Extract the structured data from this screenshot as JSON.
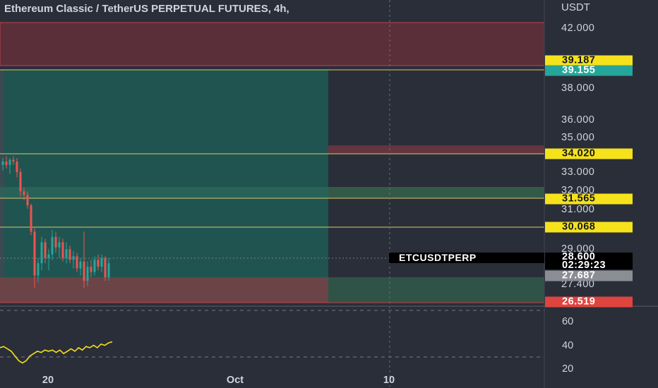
{
  "header": {
    "title": "Ethereum Classic / TetherUS PERPETUAL FUTURES, 4h,",
    "currency": "USDT"
  },
  "price_axis": {
    "ticks": [
      "42.000",
      "38.000",
      "36.000",
      "35.000",
      "33.000",
      "32.000",
      "31.000",
      "29.000",
      "27.400"
    ],
    "badges": [
      {
        "label": "39.187",
        "bg": "#f5e21b",
        "fg": "#131722"
      },
      {
        "label": "39.155",
        "bg": "#26a69a",
        "fg": "#ffffff"
      },
      {
        "label": "34.020",
        "bg": "#f5e21b",
        "fg": "#131722"
      },
      {
        "label": "31.565",
        "bg": "#f5e21b",
        "fg": "#131722"
      },
      {
        "label": "30.068",
        "bg": "#f5e21b",
        "fg": "#131722"
      },
      {
        "label": "27.687",
        "bg": "#8a8d94",
        "fg": "#ffffff"
      },
      {
        "label": "26.519",
        "bg": "#e0443e",
        "fg": "#ffffff"
      }
    ]
  },
  "last_price": {
    "symbol": "ETCUSDTPERP",
    "price": "28.600",
    "countdown": "02:29:23"
  },
  "oscillator_axis": {
    "ticks": [
      "60",
      "40",
      "20"
    ]
  },
  "time_axis": {
    "labels": [
      "20",
      "Oct",
      "10"
    ]
  },
  "colors": {
    "background": "#2a2e39",
    "up": "#26a69a",
    "down": "#ef5350",
    "level_line": "#f5e21b",
    "oscillator": "#f5e21b"
  },
  "chart_data": {
    "type": "candlestick",
    "symbol": "ETCUSDTPERP",
    "interval": "4h",
    "price_range": [
      26.0,
      43.0
    ],
    "ohlc": [
      [
        34.2,
        34.6,
        33.9,
        34.4
      ],
      [
        34.4,
        34.7,
        34.0,
        34.2
      ],
      [
        34.2,
        34.6,
        33.7,
        34.5
      ],
      [
        34.5,
        34.7,
        34.2,
        34.4
      ],
      [
        34.4,
        34.6,
        33.5,
        33.8
      ],
      [
        33.8,
        34.0,
        32.4,
        32.7
      ],
      [
        32.7,
        32.9,
        32.2,
        32.5
      ],
      [
        32.5,
        32.7,
        31.7,
        31.9
      ],
      [
        31.9,
        32.0,
        30.2,
        30.4
      ],
      [
        30.4,
        30.6,
        27.2,
        27.9
      ],
      [
        27.9,
        28.9,
        27.5,
        28.6
      ],
      [
        28.6,
        30.1,
        28.2,
        29.8
      ],
      [
        29.8,
        30.0,
        28.6,
        28.9
      ],
      [
        28.9,
        29.4,
        28.2,
        29.1
      ],
      [
        29.1,
        30.5,
        28.8,
        30.1
      ],
      [
        30.1,
        30.4,
        29.2,
        29.5
      ],
      [
        29.5,
        30.1,
        28.9,
        29.8
      ],
      [
        29.8,
        30.0,
        28.7,
        28.9
      ],
      [
        28.9,
        29.8,
        28.6,
        29.4
      ],
      [
        29.4,
        29.6,
        28.6,
        28.8
      ],
      [
        28.8,
        29.3,
        28.3,
        29.0
      ],
      [
        29.0,
        29.2,
        28.1,
        28.3
      ],
      [
        28.3,
        28.9,
        27.9,
        28.7
      ],
      [
        28.7,
        30.4,
        27.2,
        27.6
      ],
      [
        27.6,
        28.7,
        27.3,
        28.4
      ],
      [
        28.4,
        28.8,
        27.8,
        28.1
      ],
      [
        28.1,
        29.0,
        27.9,
        28.8
      ],
      [
        28.8,
        29.1,
        28.2,
        28.4
      ],
      [
        28.4,
        29.1,
        28.1,
        28.9
      ],
      [
        28.9,
        29.0,
        27.6,
        27.8
      ],
      [
        27.8,
        28.9,
        27.6,
        28.6
      ]
    ],
    "levels": [
      39.187,
      39.155,
      34.02,
      31.565,
      30.068,
      27.687,
      26.519
    ],
    "oscillator_values": [
      38,
      39,
      37,
      35,
      31,
      27,
      25,
      27,
      31,
      33,
      35,
      34,
      36,
      35,
      36,
      34,
      36,
      33,
      35,
      37,
      35,
      38,
      36,
      39,
      38,
      40,
      38,
      41,
      40,
      42,
      43
    ],
    "oscillator_range": [
      15,
      70
    ]
  }
}
